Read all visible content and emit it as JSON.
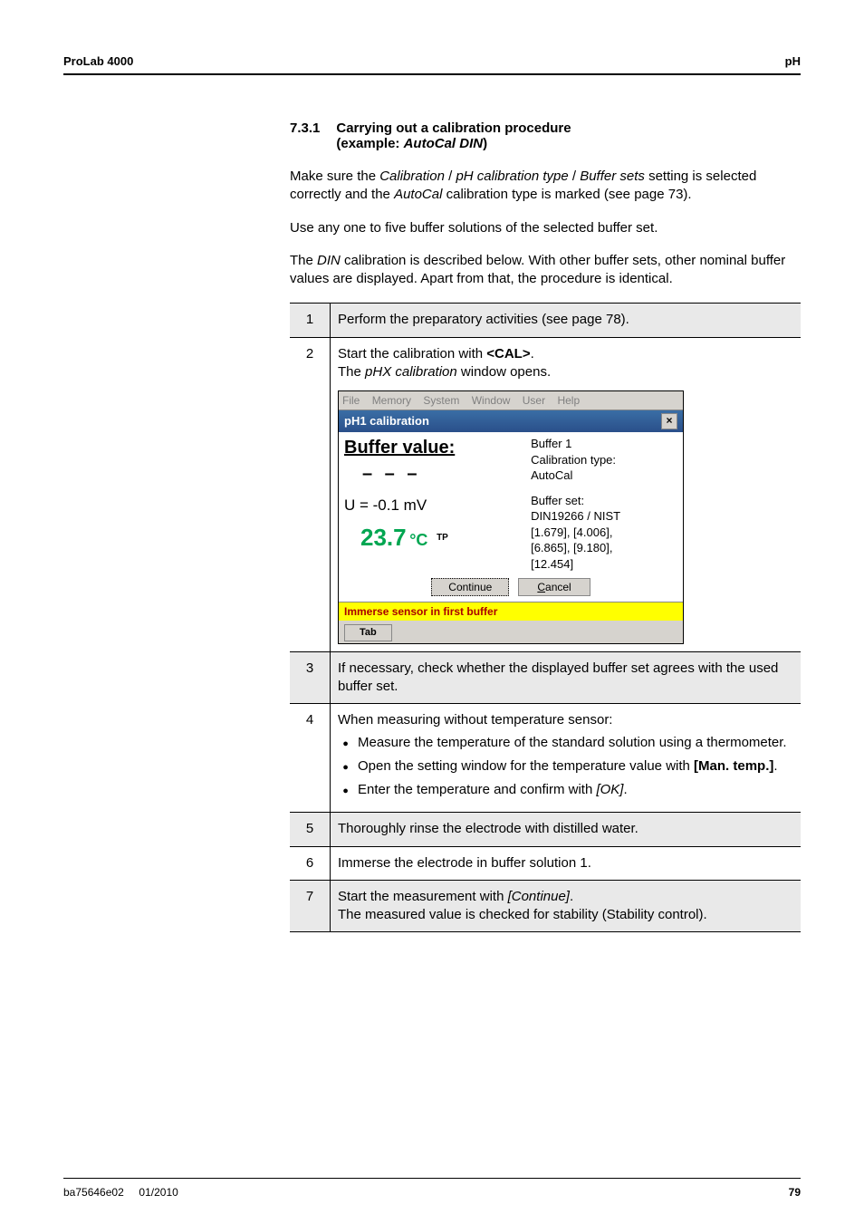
{
  "header": {
    "left": "ProLab 4000",
    "right": "pH"
  },
  "section": {
    "number": "7.3.1",
    "title_line1": "Carrying out a calibration procedure",
    "title_line2": "(example: ",
    "title_emph": "AutoCal DIN",
    "title_end": ")"
  },
  "paragraphs": {
    "p1a": "Make sure the ",
    "p1i1": "Calibration",
    "p1b": " / ",
    "p1i2": "pH calibration type",
    "p1c": " / ",
    "p1i3": "Buffer sets",
    "p1d": " setting is selected correctly and the ",
    "p1i4": "AutoCal",
    "p1e": " calibration type is marked (see page 73).",
    "p2": "Use any one to five buffer solutions of the selected buffer set.",
    "p3a": "The ",
    "p3i": "DIN",
    "p3b": " calibration is described below. With other buffer sets, other nominal buffer values are displayed. Apart from that, the procedure is identical."
  },
  "steps": {
    "s1": {
      "n": "1",
      "text": "Perform the preparatory activities (see page 78)."
    },
    "s2": {
      "n": "2",
      "t1": "Start the calibration with ",
      "bold": "<CAL>",
      "t1b": ".",
      "t2a": "The ",
      "t2i": "pHX calibration",
      "t2b": " window opens."
    },
    "s3": {
      "n": "3",
      "text": "If necessary, check whether the displayed buffer set agrees with the used buffer set."
    },
    "s4": {
      "n": "4",
      "lead": "When measuring without temperature sensor:",
      "b1": "Measure the temperature of the standard solution using a thermometer.",
      "b2a": "Open the setting window for the temperature value with ",
      "b2bold": "[Man. temp.]",
      "b2b": ".",
      "b3a": "Enter the temperature and confirm with ",
      "b3i": "[OK]",
      "b3b": "."
    },
    "s5": {
      "n": "5",
      "text": "Thoroughly rinse the electrode with distilled water."
    },
    "s6": {
      "n": "6",
      "text": "Immerse the electrode in buffer solution 1."
    },
    "s7": {
      "n": "7",
      "t1": "Start the measurement with ",
      "i": "[Continue]",
      "t1b": ".",
      "t2": "The measured value is checked for stability (Stability control)."
    }
  },
  "shot": {
    "menu": {
      "file": "File",
      "memory": "Memory",
      "system": "System",
      "window": "Window",
      "user": "User",
      "help": "Help"
    },
    "title": "pH1 calibration",
    "close": "×",
    "left": {
      "buffer_value": "Buffer value:",
      "dashes": "– – –",
      "u": "U = -0.1 mV",
      "temp": "23.7",
      "deg": "°C",
      "tp": "TP"
    },
    "right": {
      "l1": "Buffer 1",
      "l2": "Calibration type:",
      "l3": "AutoCal",
      "l4": "Buffer set:",
      "l5": "DIN19266 / NIST",
      "l6": "[1.679], [4.006],",
      "l7": "[6.865], [9.180],",
      "l8": "[12.454]"
    },
    "buttons": {
      "continue": "Continue",
      "cancel_u": "C",
      "cancel_rest": "ancel"
    },
    "status": "Immerse sensor in first buffer",
    "tab": "Tab"
  },
  "footer": {
    "left_a": "ba75646e02",
    "left_b": "01/2010",
    "right": "79"
  }
}
